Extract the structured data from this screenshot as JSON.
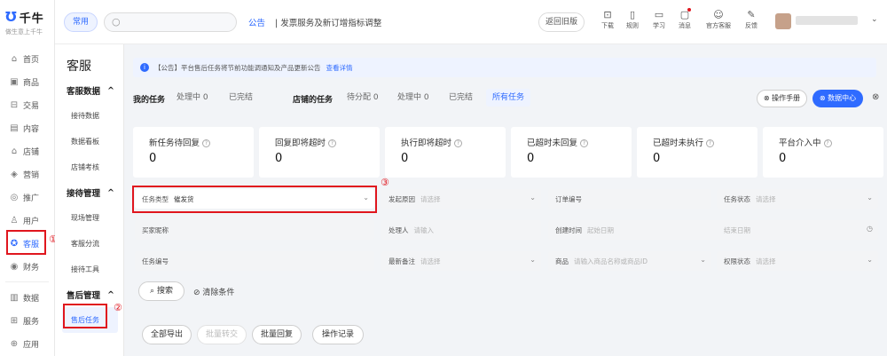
{
  "brand": {
    "name": "千牛",
    "slogan": "做生意上千牛"
  },
  "leftnav": {
    "items": [
      {
        "label": "首页",
        "icon": "home-icon",
        "glyph": "⌂"
      },
      {
        "label": "商品",
        "icon": "goods-icon",
        "glyph": "▣"
      },
      {
        "label": "交易",
        "icon": "trade-icon",
        "glyph": "⊟"
      },
      {
        "label": "内容",
        "icon": "content-icon",
        "glyph": "▤"
      },
      {
        "label": "店铺",
        "icon": "shop-icon",
        "glyph": "⌂"
      },
      {
        "label": "营销",
        "icon": "marketing-icon",
        "glyph": "◈"
      },
      {
        "label": "推广",
        "icon": "promotion-icon",
        "glyph": "◎"
      },
      {
        "label": "用户",
        "icon": "user-icon",
        "glyph": "♙"
      },
      {
        "label": "客服",
        "icon": "service-icon",
        "glyph": "✪"
      },
      {
        "label": "财务",
        "icon": "finance-icon",
        "glyph": "◉"
      },
      {
        "label": "数据",
        "icon": "data-icon",
        "glyph": "▥"
      },
      {
        "label": "服务",
        "icon": "service-market-icon",
        "glyph": "⊞"
      },
      {
        "label": "应用",
        "icon": "apps-icon",
        "glyph": "⊕"
      }
    ],
    "active_label": "客服"
  },
  "markers": {
    "one": "①",
    "two": "②",
    "three": "③"
  },
  "topbar": {
    "common_label": "常用",
    "notice_tag": "公告",
    "notice_text": "|  发票服务及新订增指标调整",
    "old_version": "返回旧版",
    "tools": [
      {
        "label": "下载",
        "icon": "download-icon",
        "glyph": "⊡"
      },
      {
        "label": "规则",
        "icon": "rules-icon",
        "glyph": "▯"
      },
      {
        "label": "学习",
        "icon": "learn-icon",
        "glyph": "▭"
      },
      {
        "label": "消息",
        "icon": "message-icon",
        "glyph": "▢"
      },
      {
        "label": "官方客服",
        "icon": "official-service-icon",
        "glyph": "☺"
      },
      {
        "label": "反馈",
        "icon": "feedback-icon",
        "glyph": "✎"
      }
    ],
    "caret": "⌄"
  },
  "subnav": {
    "title": "客服",
    "groups": [
      {
        "label": "客服数据",
        "items": [
          "接待数据",
          "数据看板",
          "店铺考核"
        ]
      },
      {
        "label": "接待管理",
        "items": [
          "现场管理",
          "客服分流",
          "接待工具"
        ]
      },
      {
        "label": "售后管理",
        "items": [
          "售后任务"
        ]
      }
    ],
    "collapse_glyph": "^"
  },
  "announcement": {
    "icon_glyph": "i",
    "text": "【公告】平台售后任务将节前功能调通知及产品更新公告",
    "link": "查看详情"
  },
  "tasks": {
    "my_label": "我的任务",
    "my_tabs": [
      "处理中 0",
      "已完结"
    ],
    "shop_label": "店铺的任务",
    "shop_tabs": [
      "待分配 0",
      "处理中 0",
      "已完结",
      "所有任务"
    ],
    "manual_btn": "⊗ 操作手册",
    "data_btn": "⊗ 数据中心",
    "grid_glyph": "⊗"
  },
  "stats": [
    {
      "label": "新任务待回复",
      "value": "0"
    },
    {
      "label": "回复即将超时",
      "value": "0"
    },
    {
      "label": "执行即将超时",
      "value": "0"
    },
    {
      "label": "已超时未回复",
      "value": "0"
    },
    {
      "label": "已超时未执行",
      "value": "0"
    },
    {
      "label": "平台介入中",
      "value": "0"
    }
  ],
  "help_glyph": "?",
  "filters": {
    "task_type_label": "任务类型",
    "task_type_value": "催发货",
    "publisher_label": "发起原因",
    "publisher_ph": "请选择",
    "order_label": "订单编号",
    "task_status_label": "任务状态",
    "task_status_ph": "请选择",
    "buyer_label": "买家昵称",
    "handler_label": "处理人",
    "handler_ph": "请输入",
    "created_label": "创建时间",
    "created_start_ph": "起始日期",
    "created_end_ph": "结束日期",
    "task_no_label": "任务编号",
    "latest_note_label": "最新备注",
    "latest_note_ph": "请选择",
    "goods_label": "商品",
    "goods_ph": "请输入商品名称或商品ID",
    "permission_label": "权限状态",
    "permission_ph": "请选择",
    "caret": "⌄",
    "clock": "◷"
  },
  "actions": {
    "search": "⌕ 搜索",
    "clear": "⊘ 清除条件",
    "export_all": "全部导出",
    "batch_transfer": "批量转交",
    "batch_reply": "批量回复",
    "op_log": "操作记录"
  }
}
